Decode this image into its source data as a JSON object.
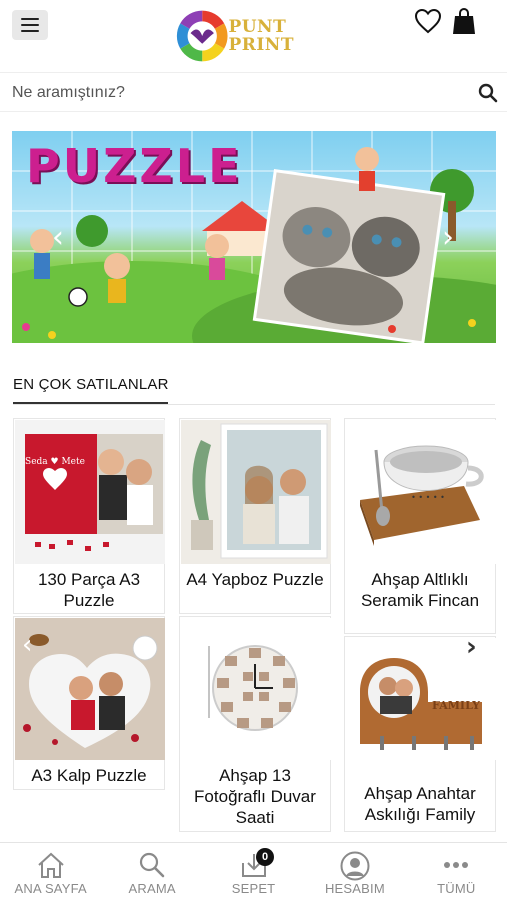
{
  "header": {
    "logo_line1": "PUNT",
    "logo_line2": "PRINT"
  },
  "search": {
    "placeholder": "Ne aramıştınız?"
  },
  "banner": {
    "title": "PUZZLE",
    "prev_arrow": "‹",
    "next_arrow": "›"
  },
  "section": {
    "title": "EN ÇOK SATILANLAR"
  },
  "products": [
    {
      "name": "130 Parça A3 Puzzle"
    },
    {
      "name": "A4 Yapboz Puzzle"
    },
    {
      "name": "Ahşap Altlıklı Seramik Fincan"
    },
    {
      "name": "A3 Kalp Puzzle"
    },
    {
      "name": "Ahşap 13 Fotoğraflı Duvar Saati"
    },
    {
      "name": "Ahşap Anahtar Askılığı Family"
    }
  ],
  "product_image_labels": {
    "puzzle_names": "Seda ♥ Mete",
    "family_text": "FAMILY"
  },
  "carousel": {
    "prev_arrow": "‹",
    "next_arrow": "›"
  },
  "bottom_nav": {
    "items": [
      {
        "label": "ANA SAYFA",
        "icon": "home-icon"
      },
      {
        "label": "ARAMA",
        "icon": "search-icon"
      },
      {
        "label": "SEPET",
        "icon": "cart-icon"
      },
      {
        "label": "HESABIM",
        "icon": "account-icon"
      },
      {
        "label": "TÜMÜ",
        "icon": "more-icon"
      }
    ],
    "cart_count": "0"
  },
  "colors": {
    "logo_gold": "#d8b13a",
    "banner_title": "#cc1f8f",
    "nav_label": "#8a8a8a"
  }
}
